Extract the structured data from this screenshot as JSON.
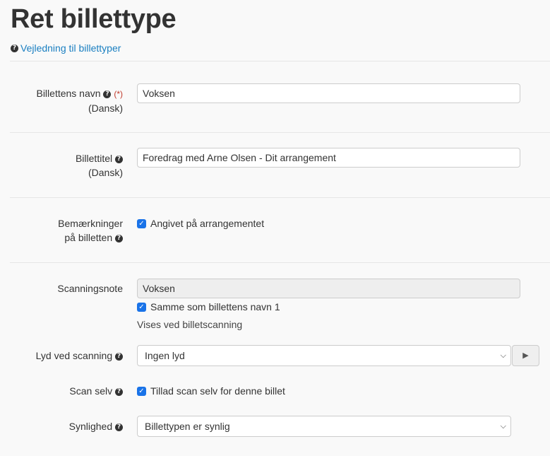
{
  "page": {
    "title": "Ret billettype",
    "help_link": "Vejledning til billettyper"
  },
  "fields": {
    "name": {
      "label": "Billettens navn",
      "required_mark": "(*)",
      "lang": "(Dansk)",
      "value": "Voksen"
    },
    "ticket_title": {
      "label": "Billettitel",
      "lang": "(Dansk)",
      "value": "Foredrag med Arne Olsen - Dit arrangement"
    },
    "remarks": {
      "label_line1": "Bemærkninger",
      "label_line2": "på billetten",
      "checkbox_label": "Angivet på arrangementet",
      "checked": true
    },
    "scan_note": {
      "label": "Scanningsnote",
      "value": "Voksen",
      "checkbox_label": "Samme som billettens navn 1",
      "checked": true,
      "hint": "Vises ved billetscanning"
    },
    "scan_sound": {
      "label": "Lyd ved scanning",
      "selected": "Ingen lyd",
      "play_icon": "play-icon"
    },
    "self_scan": {
      "label": "Scan selv",
      "checkbox_label": "Tillad scan selv for denne billet",
      "checked": true
    },
    "visibility": {
      "label": "Synlighed",
      "selected": "Billettypen er synlig"
    }
  },
  "colors": {
    "link": "#1a7fc1",
    "checkbox": "#1a73e8",
    "required": "#c0392b"
  }
}
